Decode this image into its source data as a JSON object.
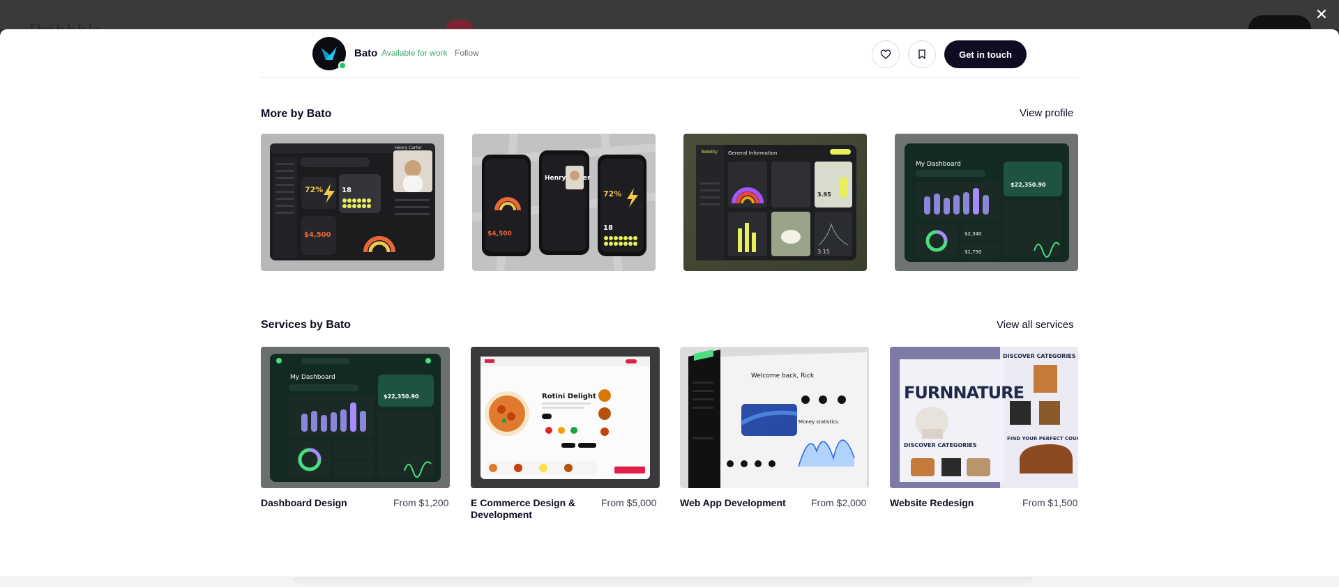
{
  "backdrop": {
    "logo_text": "Dribbble"
  },
  "modal": {
    "close_icon": "close-icon"
  },
  "header": {
    "author_name": "Bato",
    "availability": "Available for work",
    "follow_label": "Follow",
    "get_in_touch_label": "Get in touch",
    "icons": [
      "heart-icon",
      "bookmark-icon"
    ],
    "accent": "#3fa86b"
  },
  "more_by": {
    "title": "More by Bato",
    "link": "View profile",
    "shots": [
      {
        "name": "Henry Carter",
        "stat": "72%",
        "amount": "$4,500",
        "count": "18"
      },
      {
        "name": "Henry Carter",
        "stat": "72%",
        "amount": "$4,500",
        "count": "18"
      },
      {
        "name": "Nobility",
        "heading": "General Information",
        "value_a": "3.95",
        "value_b": "3.15"
      },
      {
        "name": "My Dashboard",
        "amount": "$22,350.90",
        "income": "$2,340",
        "expense": "$1,750"
      }
    ]
  },
  "services": {
    "title": "Services by Bato",
    "link": "View all services",
    "items": [
      {
        "title": "Dashboard Design",
        "price": "From $1,200",
        "thumb_heading": "My Dashboard",
        "thumb_amount": "$22,350.90"
      },
      {
        "title": "E Commerce Design & Development",
        "price": "From $5,000",
        "thumb_heading": "Rotini Delight"
      },
      {
        "title": "Web App Development",
        "price": "From $2,000",
        "thumb_heading": "Welcome back, Rick",
        "thumb_stat": "Money statistics"
      },
      {
        "title": "Website Redesign",
        "price": "From $1,500",
        "thumb_heading": "FURNNATURE",
        "thumb_sub": "DISCOVER CATEGORIES",
        "thumb_sub2": "FIND YOUR PERFECT COUCH"
      }
    ]
  }
}
